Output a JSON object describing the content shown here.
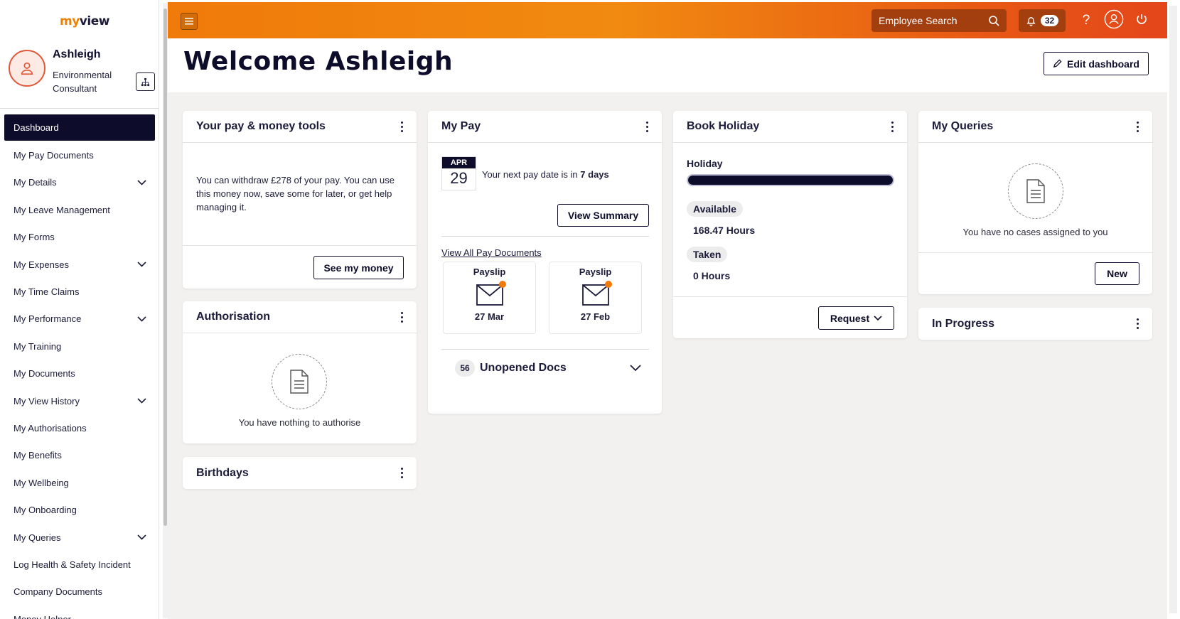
{
  "app": {
    "logo_prefix": "my",
    "logo_suffix": "view"
  },
  "profile": {
    "name": "Ashleigh",
    "role": "Environmental Consultant"
  },
  "sidebar": {
    "items": [
      {
        "label": "Dashboard",
        "active": true,
        "expandable": false
      },
      {
        "label": "My Pay Documents",
        "expandable": false
      },
      {
        "label": "My Details",
        "expandable": true
      },
      {
        "label": "My Leave Management",
        "expandable": false
      },
      {
        "label": "My Forms",
        "expandable": false
      },
      {
        "label": "My Expenses",
        "expandable": true
      },
      {
        "label": "My Time Claims",
        "expandable": false
      },
      {
        "label": "My Performance",
        "expandable": true
      },
      {
        "label": "My Training",
        "expandable": false
      },
      {
        "label": "My Documents",
        "expandable": false
      },
      {
        "label": "My View History",
        "expandable": true
      },
      {
        "label": "My Authorisations",
        "expandable": false
      },
      {
        "label": "My Benefits",
        "expandable": false
      },
      {
        "label": "My Wellbeing",
        "expandable": false
      },
      {
        "label": "My Onboarding",
        "expandable": false
      },
      {
        "label": "My Queries",
        "expandable": true
      },
      {
        "label": "Log Health & Safety Incident",
        "expandable": false
      },
      {
        "label": "Company Documents",
        "expandable": false
      },
      {
        "label": "Money Helper",
        "expandable": false
      }
    ]
  },
  "header": {
    "search_placeholder": "Employee Search",
    "notification_count": "32",
    "help_label": "?"
  },
  "main": {
    "welcome": "Welcome Ashleigh",
    "edit_dashboard": "Edit dashboard"
  },
  "cards": {
    "pay_tools": {
      "title": "Your pay & money tools",
      "text": "You can withdraw £278 of your pay. You can use this money now, save some for later, or get help managing it.",
      "button": "See my money"
    },
    "authorisation": {
      "title": "Authorisation",
      "empty_text": "You have nothing to authorise"
    },
    "birthdays": {
      "title": "Birthdays"
    },
    "my_pay": {
      "title": "My Pay",
      "cal_month": "APR",
      "cal_day": "29",
      "next_pay_prefix": "Your next pay date is in",
      "next_pay_days": "7 days",
      "view_summary": "View Summary",
      "view_all": "View All Pay Documents",
      "payslips": [
        {
          "title": "Payslip",
          "date": "27 Mar"
        },
        {
          "title": "Payslip",
          "date": "27 Feb"
        }
      ],
      "unopened_count": "56",
      "unopened_label": "Unopened Docs"
    },
    "holiday": {
      "title": "Book Holiday",
      "label": "Holiday",
      "bar_fill": 1.0,
      "available_label": "Available",
      "available_value": "168.47 Hours",
      "taken_label": "Taken",
      "taken_value": "0 Hours",
      "request": "Request"
    },
    "queries": {
      "title": "My Queries",
      "empty_text": "You have no cases assigned to you",
      "new_button": "New"
    },
    "in_progress": {
      "title": "In Progress"
    }
  },
  "colors": {
    "brand_orange": "#f07a0a",
    "navy": "#0d0d2b",
    "canvas": "#f3f1ef"
  }
}
